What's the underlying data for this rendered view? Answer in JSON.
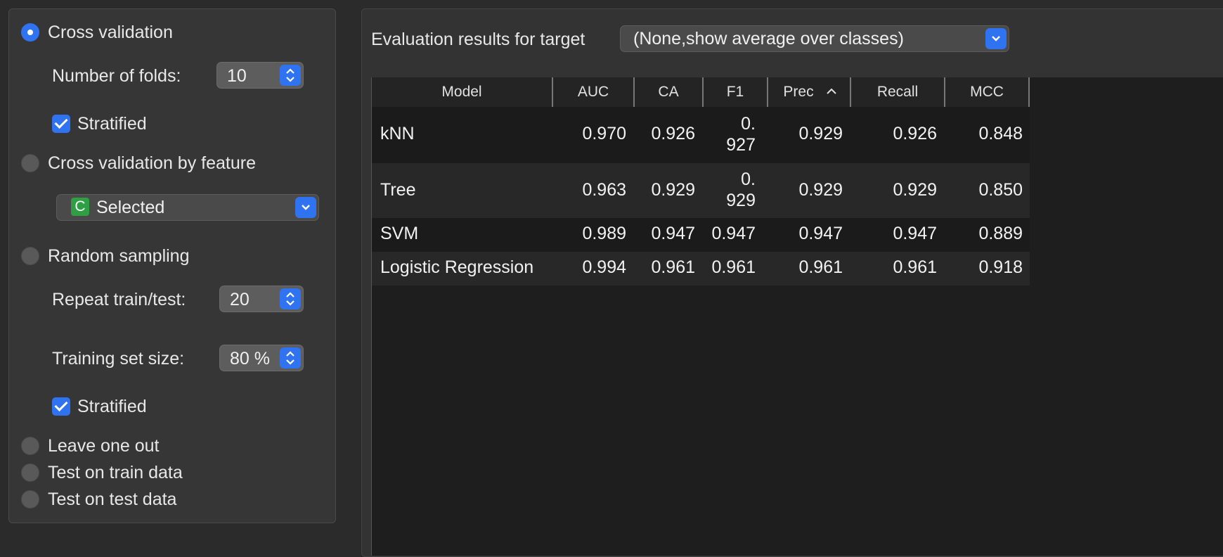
{
  "left": {
    "cross_validation": {
      "label": "Cross validation",
      "selected": true
    },
    "folds": {
      "label": "Number of folds:",
      "value": "10"
    },
    "stratified_1": {
      "label": "Stratified",
      "checked": true
    },
    "cv_by_feature": {
      "label": "Cross validation by feature",
      "selected": false
    },
    "feature_select": {
      "badge": "C",
      "value": "Selected"
    },
    "random_sampling": {
      "label": "Random sampling",
      "selected": false
    },
    "repeat": {
      "label": "Repeat train/test:",
      "value": "20"
    },
    "training_size": {
      "label": "Training set size:",
      "value": "80 %"
    },
    "stratified_2": {
      "label": "Stratified",
      "checked": true
    },
    "leave_one_out": {
      "label": "Leave one out",
      "selected": false
    },
    "test_on_train": {
      "label": "Test on train data",
      "selected": false
    },
    "test_on_test": {
      "label": "Test on test data",
      "selected": false
    }
  },
  "eval": {
    "label": "Evaluation results for target",
    "target_value": "(None,show average over classes)"
  },
  "table": {
    "headers": [
      "Model",
      "AUC",
      "CA",
      "F1",
      "Prec",
      "Recall",
      "MCC"
    ],
    "rows": [
      {
        "model": "kNN",
        "auc": "0.970",
        "ca": "0.926",
        "f1_a": "0.",
        "f1_b": "927",
        "prec": "0.929",
        "recall": "0.926",
        "mcc": "0.848"
      },
      {
        "model": "Tree",
        "auc": "0.963",
        "ca": "0.929",
        "f1_a": "0.",
        "f1_b": "929",
        "prec": "0.929",
        "recall": "0.929",
        "mcc": "0.850"
      },
      {
        "model": "SVM",
        "auc": "0.989",
        "ca": "0.947",
        "f1": "0.947",
        "prec": "0.947",
        "recall": "0.947",
        "mcc": "0.889"
      },
      {
        "model": "Logistic Regression",
        "auc": "0.994",
        "ca": "0.961",
        "f1": "0.961",
        "prec": "0.961",
        "recall": "0.961",
        "mcc": "0.918"
      }
    ],
    "sort_column": "Prec",
    "sort_direction": "ascending"
  },
  "colors": {
    "accent": "#2f73f0",
    "badge": "#2ea043"
  }
}
